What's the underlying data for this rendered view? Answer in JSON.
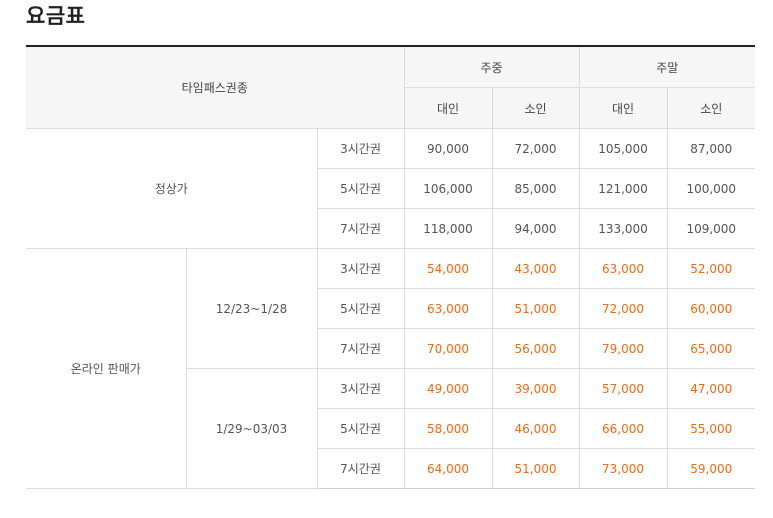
{
  "page_title": "요금표",
  "headers": {
    "type_label": "타임패스권종",
    "weekday": "주중",
    "weekend": "주말",
    "adult": "대인",
    "child": "소인"
  },
  "regular": {
    "label": "정상가",
    "rows": [
      {
        "duration": "3시간권",
        "wd_adult": "90,000",
        "wd_child": "72,000",
        "we_adult": "105,000",
        "we_child": "87,000"
      },
      {
        "duration": "5시간권",
        "wd_adult": "106,000",
        "wd_child": "85,000",
        "we_adult": "121,000",
        "we_child": "100,000"
      },
      {
        "duration": "7시간권",
        "wd_adult": "118,000",
        "wd_child": "94,000",
        "we_adult": "133,000",
        "we_child": "109,000"
      }
    ]
  },
  "online": {
    "label": "온라인 판매가",
    "periods": [
      {
        "period": "12/23~1/28",
        "rows": [
          {
            "duration": "3시간권",
            "wd_adult": "54,000",
            "wd_child": "43,000",
            "we_adult": "63,000",
            "we_child": "52,000"
          },
          {
            "duration": "5시간권",
            "wd_adult": "63,000",
            "wd_child": "51,000",
            "we_adult": "72,000",
            "we_child": "60,000"
          },
          {
            "duration": "7시간권",
            "wd_adult": "70,000",
            "wd_child": "56,000",
            "we_adult": "79,000",
            "we_child": "65,000"
          }
        ]
      },
      {
        "period": "1/29~03/03",
        "rows": [
          {
            "duration": "3시간권",
            "wd_adult": "49,000",
            "wd_child": "39,000",
            "we_adult": "57,000",
            "we_child": "47,000"
          },
          {
            "duration": "5시간권",
            "wd_adult": "58,000",
            "wd_child": "46,000",
            "we_adult": "66,000",
            "we_child": "55,000"
          },
          {
            "duration": "7시간권",
            "wd_adult": "64,000",
            "wd_child": "51,000",
            "we_adult": "73,000",
            "we_child": "59,000"
          }
        ]
      }
    ]
  },
  "colors": {
    "sale_price": "#f06a15",
    "header_bg": "#f6f6f6",
    "border": "#dddddd",
    "top_rule": "#222222"
  }
}
